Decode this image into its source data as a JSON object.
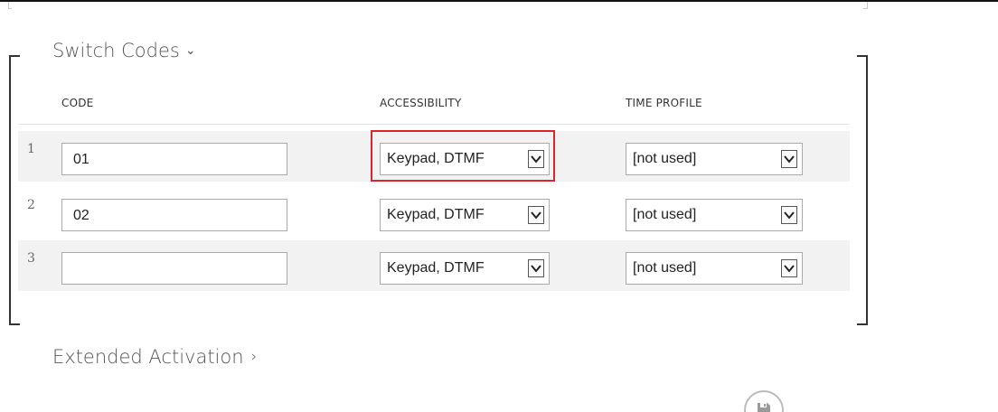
{
  "switch_codes": {
    "title": "Switch Codes",
    "columns": {
      "code": "CODE",
      "accessibility": "ACCESSIBILITY",
      "time_profile": "TIME PROFILE"
    },
    "rows": [
      {
        "num": "1",
        "code": "01",
        "accessibility": "Keypad, DTMF",
        "time_profile": "[not used]"
      },
      {
        "num": "2",
        "code": "02",
        "accessibility": "Keypad, DTMF",
        "time_profile": "[not used]"
      },
      {
        "num": "3",
        "code": "",
        "accessibility": "Keypad, DTMF",
        "time_profile": "[not used]"
      }
    ]
  },
  "extended_activation": {
    "title": "Extended Activation"
  },
  "icons": {
    "section_expand": "chevron-down-icon",
    "section_collapsed": "chevron-right-icon",
    "select_arrow": "dropdown-arrow-icon",
    "save": "floppy-disk-icon"
  },
  "colors": {
    "highlight": "#d9262c",
    "row_shade": "#f2f2f2"
  }
}
